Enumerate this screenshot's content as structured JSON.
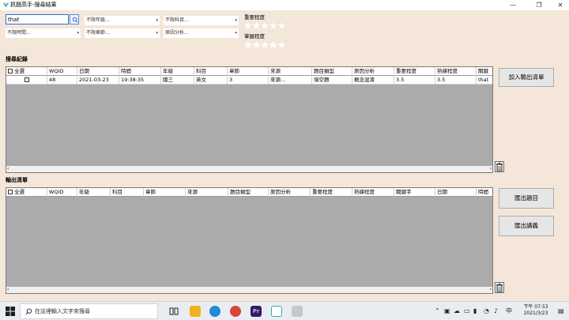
{
  "window": {
    "title": "抓題高手-搜尋結果",
    "minimize": "—",
    "maximize": "❐",
    "close": "✕"
  },
  "search": {
    "value": "that"
  },
  "filters": {
    "grade": "不限年級...",
    "subject": "不限科目...",
    "time": "不限時間...",
    "chapter": "不限章節...",
    "reason": "原因分析..."
  },
  "ratings": {
    "importance_label": "重要程度",
    "mastery_label": "掌握程度",
    "importance_stars": "★★★★★",
    "mastery_stars": "★★★★★"
  },
  "search_records": {
    "label": "搜尋紀錄",
    "select_all": "全選",
    "columns": [
      "WQID",
      "日期",
      "時間",
      "年級",
      "科目",
      "章節",
      "來源",
      "題目類型",
      "原因分析",
      "重要程度",
      "熟練程度",
      "關鍵"
    ],
    "rows": [
      {
        "wqid": "48",
        "date": "2021-03-23",
        "time": "19:38:35",
        "grade": "國三",
        "subject": "英文",
        "chapter": "3",
        "source": "來源...",
        "type": "填空題",
        "reason": "概念混淆",
        "importance": "3.5",
        "mastery": "3.5",
        "keyword": "that"
      }
    ]
  },
  "output_list": {
    "label": "輸出清單",
    "select_all": "全選",
    "columns": [
      "WQID",
      "年級",
      "科目",
      "章節",
      "來源",
      "題目類型",
      "原因分析",
      "重要程度",
      "熟練程度",
      "關鍵字",
      "日期",
      "時間"
    ]
  },
  "buttons": {
    "add_output": "加入輸出清單",
    "export_questions": "匯出題目",
    "export_handout": "匯出講義"
  },
  "taskbar": {
    "search_placeholder": "在這裡輸入文字來搜尋",
    "time": "下午 07:53",
    "date": "2021/3/23",
    "ime": "中",
    "premiere_label": "Pr"
  },
  "colors": {
    "window_bg": "#f5e6da",
    "grid_bg": "#ababab",
    "accent": "#2f6fd6"
  }
}
